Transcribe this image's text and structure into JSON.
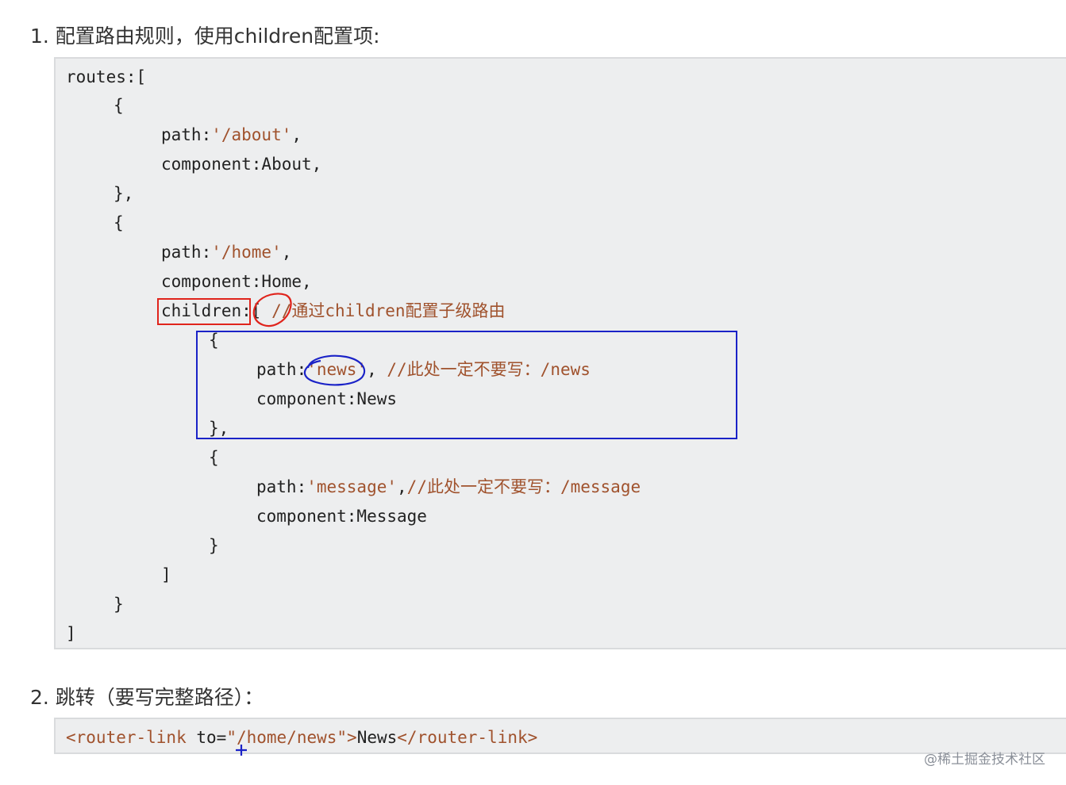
{
  "step1": {
    "title": "1. 配置路由规则，使用children配置项:",
    "lines": {
      "routes_open": "routes:[",
      "brace1_open": "{",
      "about_path_key": "path:",
      "about_path_value": "'/about'",
      "about_path_comma": ",",
      "about_component": "component:About,",
      "brace1_close": "},",
      "brace2_open": "{",
      "home_path_key": "path:",
      "home_path_value": "'/home'",
      "home_path_comma": ",",
      "home_component": "component:Home,",
      "children_key": "children",
      "children_colon_bracket": ":[",
      "children_comment": "//通过children配置子级路由",
      "news_brace_open": "{",
      "news_path_key": "path:",
      "news_path_value": "'news'",
      "news_path_comma": ",",
      "news_comment": "//此处一定不要写：/news",
      "news_component": "component:News",
      "news_brace_close": "},",
      "message_brace_open": "{",
      "message_path_key": "path:",
      "message_path_value": "'message'",
      "message_path_comma": ",",
      "message_comment": "//此处一定不要写：/message",
      "message_component": "component:Message",
      "message_brace_close": "}",
      "children_close": "]",
      "brace2_close": "}",
      "routes_close": "]"
    }
  },
  "step2": {
    "title": "2. 跳转（要写完整路径）：",
    "code": {
      "tag_open": "<router-link",
      "attr": "to=",
      "attr_value": "\"/home/news\"",
      "tag_end": ">",
      "text": "News",
      "tag_close": "</router-link>"
    }
  },
  "watermark": "@稀土掘金技术社区",
  "colors": {
    "code_background": "#edeeef",
    "string_color": "#a0522d",
    "annotation_red": "#e0241c",
    "annotation_blue": "#1a22c7"
  }
}
